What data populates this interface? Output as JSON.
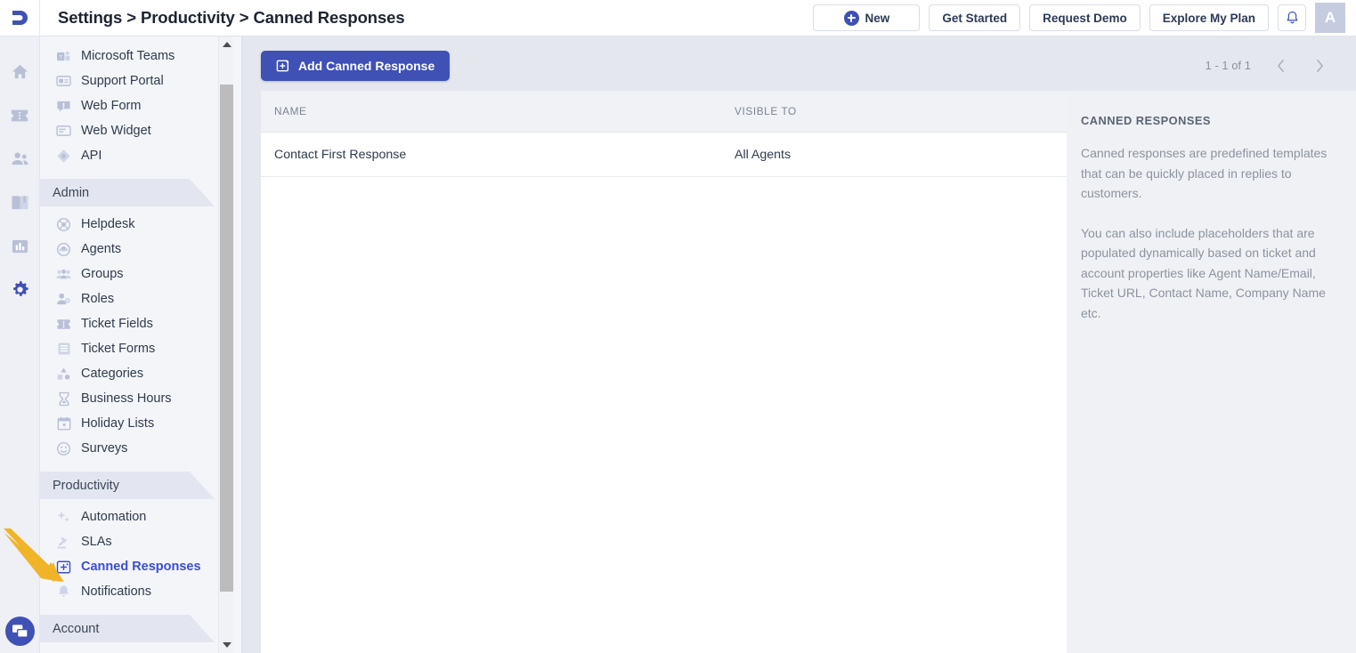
{
  "header": {
    "logo": "freshdesk-logo",
    "title": "Settings > Productivity > Canned Responses",
    "buttons": [
      {
        "label": "New",
        "name": "new-button",
        "icon": "plus-circle-icon"
      },
      {
        "label": "Get Started",
        "name": "get-started-button"
      },
      {
        "label": "Request Demo",
        "name": "request-demo-button"
      },
      {
        "label": "Explore My Plan",
        "name": "explore-my-plan-button"
      }
    ],
    "bell_icon": "bell-icon",
    "avatar_initial": "A"
  },
  "rail": {
    "items": [
      {
        "name": "rail-item-home",
        "icon": "home-icon",
        "active": false
      },
      {
        "name": "rail-item-tickets",
        "icon": "ticket-icon",
        "active": false
      },
      {
        "name": "rail-item-contacts",
        "icon": "contacts-icon",
        "active": false
      },
      {
        "name": "rail-item-solutions",
        "icon": "book-icon",
        "active": false
      },
      {
        "name": "rail-item-reports",
        "icon": "bar-chart-icon",
        "active": false
      },
      {
        "name": "rail-item-admin",
        "icon": "gear-icon",
        "active": true
      }
    ],
    "chat_icon": "chat-bubble-icon"
  },
  "sidebar": {
    "top_items": [
      {
        "label": "Microsoft Teams",
        "icon": "teams-icon"
      },
      {
        "label": "Support Portal",
        "icon": "portal-icon"
      },
      {
        "label": "Web Form",
        "icon": "web-form-icon"
      },
      {
        "label": "Web Widget",
        "icon": "web-widget-icon"
      },
      {
        "label": "API",
        "icon": "api-icon"
      }
    ],
    "admin_section": "Admin",
    "admin_items": [
      {
        "label": "Helpdesk",
        "icon": "helpdesk-icon"
      },
      {
        "label": "Agents",
        "icon": "agent-icon"
      },
      {
        "label": "Groups",
        "icon": "groups-icon"
      },
      {
        "label": "Roles",
        "icon": "roles-icon"
      },
      {
        "label": "Ticket Fields",
        "icon": "ticket-fields-icon"
      },
      {
        "label": "Ticket Forms",
        "icon": "ticket-forms-icon"
      },
      {
        "label": "Categories",
        "icon": "categories-icon"
      },
      {
        "label": "Business Hours",
        "icon": "hourglass-icon"
      },
      {
        "label": "Holiday Lists",
        "icon": "calendar-icon"
      },
      {
        "label": "Surveys",
        "icon": "smiley-icon"
      }
    ],
    "productivity_section": "Productivity",
    "productivity_items": [
      {
        "label": "Automation",
        "icon": "sparkle-icon",
        "active": false
      },
      {
        "label": "SLAs",
        "icon": "gavel-icon",
        "active": false
      },
      {
        "label": "Canned Responses",
        "icon": "canned-response-icon",
        "active": true
      },
      {
        "label": "Notifications",
        "icon": "bell-icon",
        "active": false
      }
    ],
    "account_section": "Account"
  },
  "main": {
    "add_button": "Add Canned Response",
    "add_button_icon": "canned-response-icon",
    "pagination": {
      "count": "1 - 1 of 1",
      "prev_icon": "chevron-left-icon",
      "next_icon": "chevron-right-icon"
    },
    "table": {
      "columns": [
        "NAME",
        "VISIBLE TO"
      ],
      "rows": [
        {
          "name": "Contact First Response",
          "visible_to": "All Agents"
        }
      ]
    },
    "info": {
      "title": "CANNED RESPONSES",
      "paragraph1": "Canned responses are predefined templates that can be quickly placed in replies to customers.",
      "paragraph2": "You can also include placeholders that are populated dynamically based on ticket and account properties like Agent Name/Email, Ticket URL, Contact Name, Company Name etc."
    }
  },
  "annotation": {
    "arrow_color": "#f0b429",
    "points_at": "Canned Responses"
  },
  "colors": {
    "accent": "#3f51b5",
    "active_link": "#3a4ed5",
    "content_bg": "#e4e7ee",
    "sidebar_bg": "#f4f5f9",
    "panel_bg": "#f0f1f5"
  }
}
